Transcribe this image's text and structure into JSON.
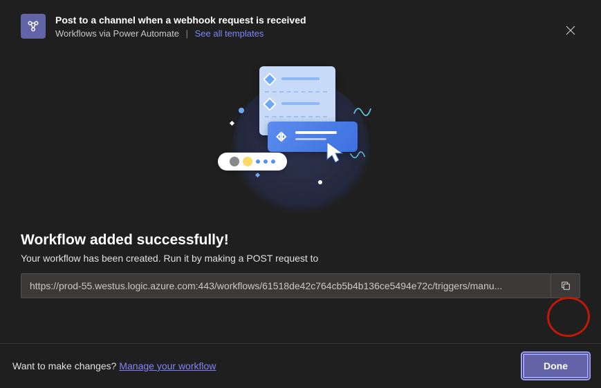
{
  "header": {
    "title": "Post to a channel when a webhook request is received",
    "subtitle": "Workflows via Power Automate",
    "see_all": "See all templates"
  },
  "content": {
    "success_title": "Workflow added successfully!",
    "success_sub": "Your workflow has been created. Run it by making a POST request to",
    "url": "https://prod-55.westus.logic.azure.com:443/workflows/61518de42c764cb5b4b136ce5494e72c/triggers/manu..."
  },
  "footer": {
    "changes_text": "Want to make changes?",
    "manage_link": "Manage your workflow",
    "done": "Done"
  }
}
